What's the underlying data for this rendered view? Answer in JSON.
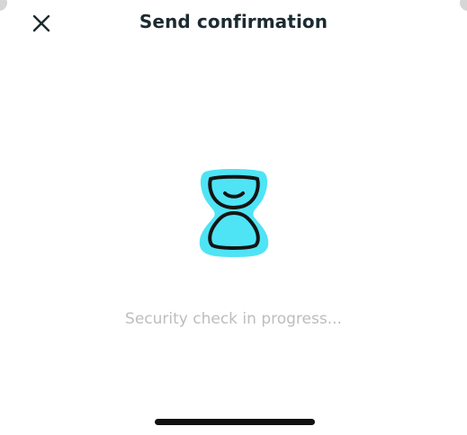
{
  "header": {
    "title": "Send confirmation",
    "close_icon": "close-icon"
  },
  "main": {
    "illustration_icon": "hourglass-icon",
    "status_text": "Security check in progress..."
  },
  "colors": {
    "title_text": "#1b2b32",
    "status_text": "#bdbdbd",
    "accent": "#4ee4f5",
    "icon_stroke": "#141414",
    "home_indicator": "#111111"
  }
}
